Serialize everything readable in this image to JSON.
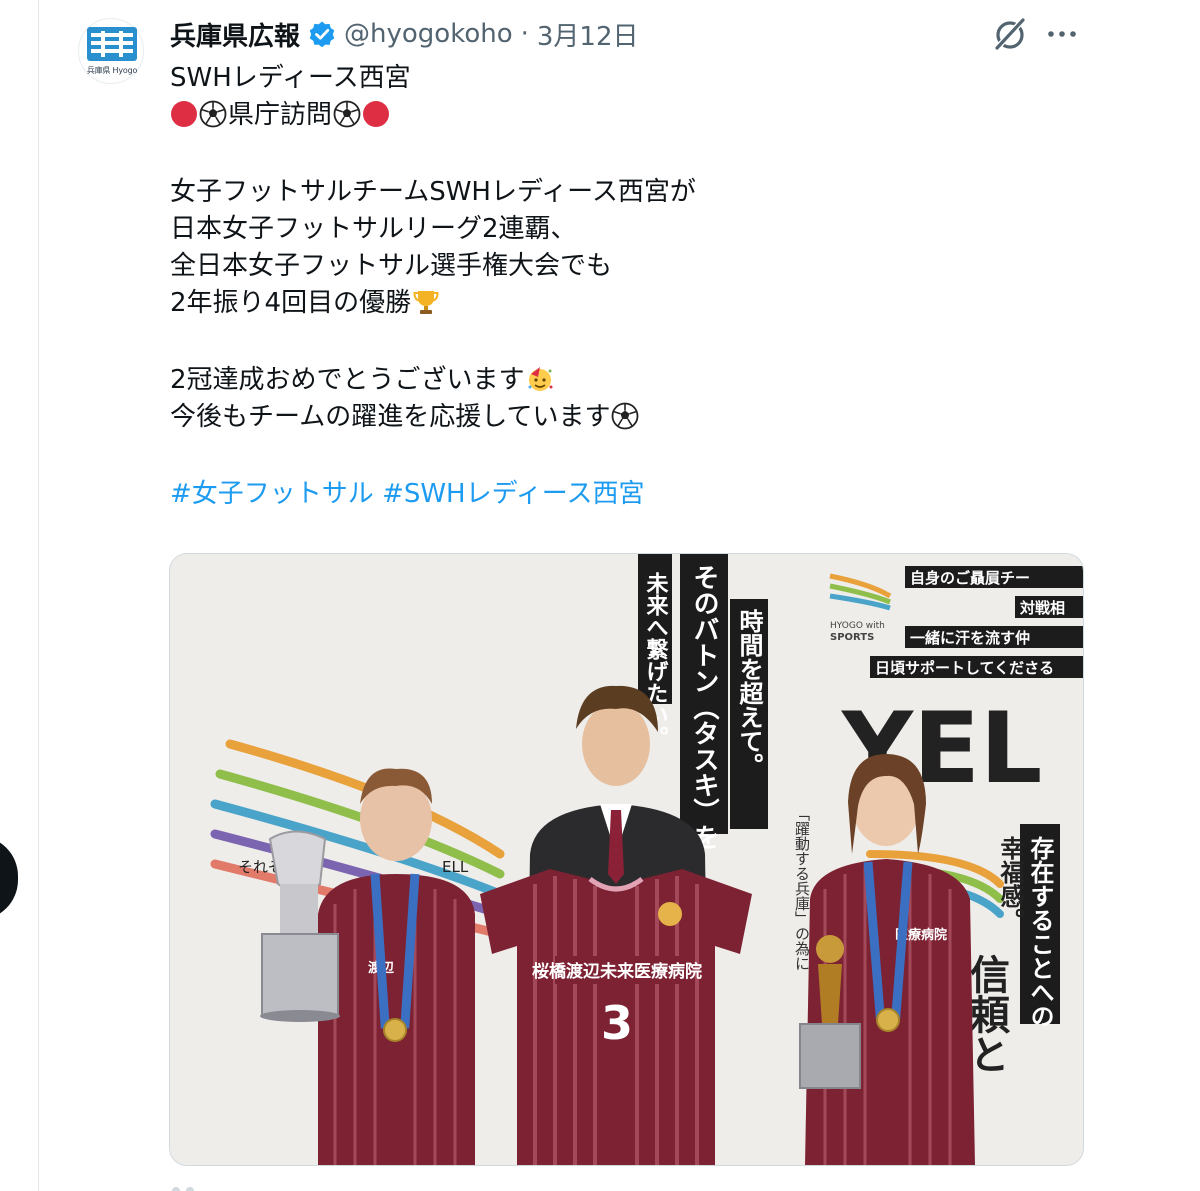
{
  "author": {
    "name": "兵庫県広報",
    "handle": "@hyogokoho",
    "separator": "·",
    "date": "3月12日",
    "avatar_caption": "兵庫県 Hyogo",
    "verified_icon": "verified-badge-icon"
  },
  "tweet": {
    "lines": [
      "SWHレディース西宮",
      "県庁訪問",
      "女子フットサルチームSWHレディース西宮が",
      "日本女子フットサルリーグ2連覇、",
      "全日本女子フットサル選手権大会でも",
      "2年振り4回目の優勝",
      "2冠達成おめでとうございます",
      "今後もチームの躍進を応援しています"
    ],
    "hashtags": [
      "#女子フットサル",
      "#SWHレディース西宮"
    ]
  },
  "media": {
    "backdrop": {
      "vertical_text_1": "そのバトン（タスキ）を",
      "vertical_text_2": "未来へ繋げたい。",
      "vertical_text_3": "時間を超えて。",
      "logo_caption_1": "HYOGO with",
      "logo_caption_2": "SPORTS",
      "banner_1": "自身のご贔屓チー",
      "banner_2": "対戦相",
      "banner_3": "一緒に汗を流す仲",
      "banner_4": "日頃サポートしてくださる",
      "big_word": "YEL",
      "right_vertical_1": "存在することへの",
      "right_vertical_2": "幸福感。",
      "right_vertical_3": "信頼と",
      "right_vertical_4": "「躍動する兵庫」の為に",
      "bottom_left": "それぞれの",
      "bottom_left_2": "ELL"
    },
    "jersey": {
      "sponsor": "桜橋渡辺未来医療病院",
      "number": "3",
      "side_sponsor": "医療病院",
      "side_sponsor_left": "渡辺"
    },
    "colors": {
      "jersey": "#7d2233",
      "stripe": "#a4495a",
      "suit": "#2b2b2e",
      "medal_ribbon": "#3b6fc2"
    }
  },
  "icons": {
    "grok": "grok-icon",
    "more": "more-icon"
  }
}
